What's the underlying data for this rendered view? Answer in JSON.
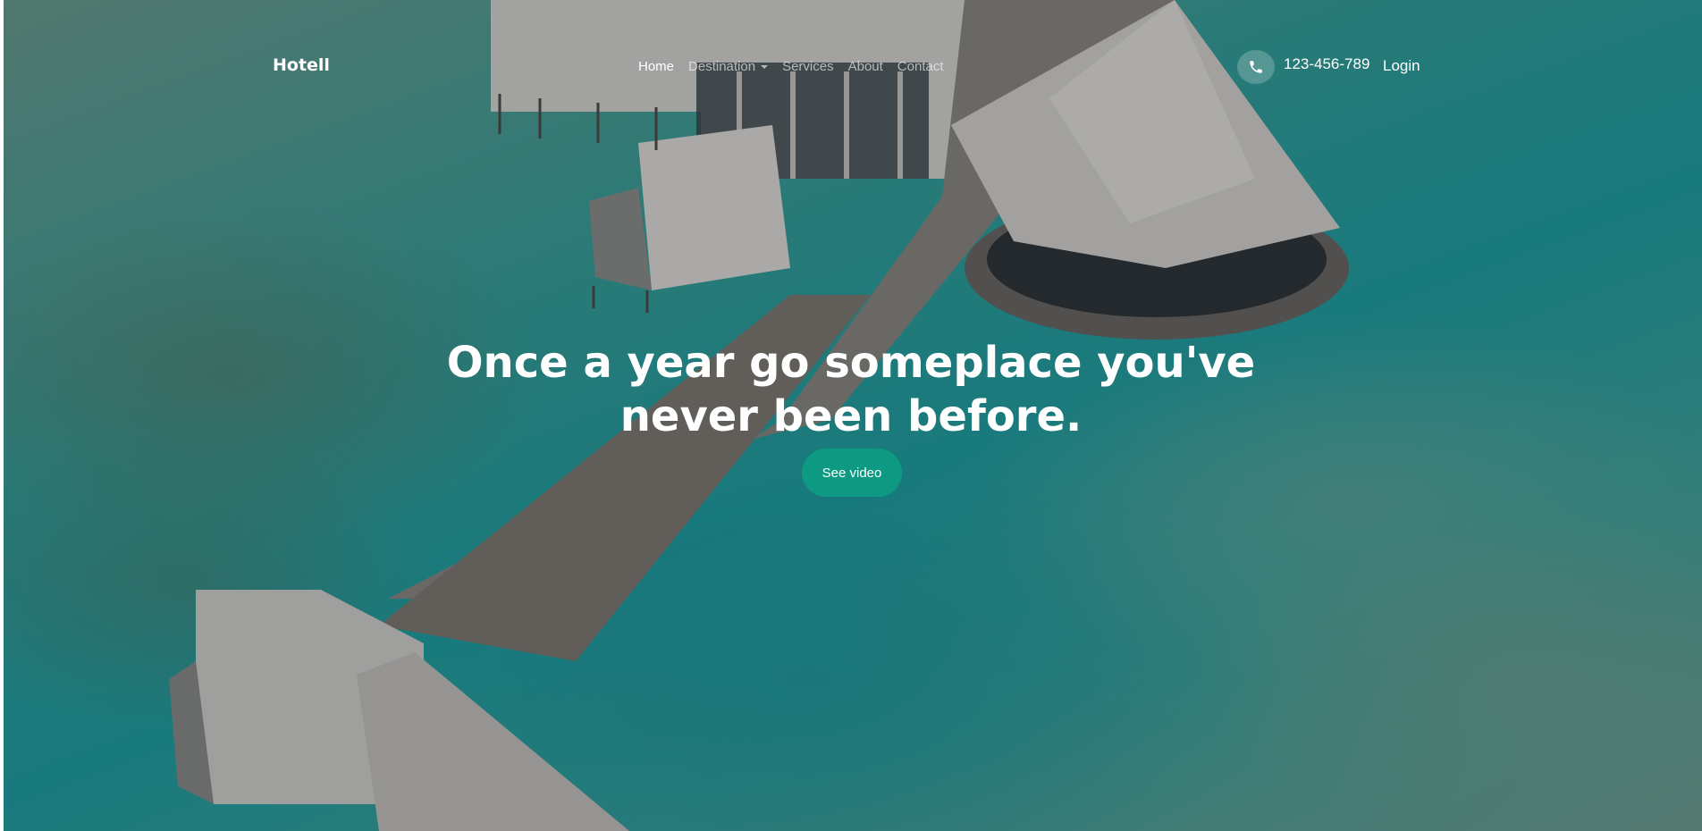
{
  "brand": {
    "name": "Hotell"
  },
  "nav": {
    "items": [
      {
        "label": "Home",
        "active": true
      },
      {
        "label": "Destination",
        "dropdown": true
      },
      {
        "label": "Services"
      },
      {
        "label": "About"
      },
      {
        "label": "Contact"
      }
    ]
  },
  "contact": {
    "phone": "123-456-789",
    "icon": "phone-icon"
  },
  "auth": {
    "login_label": "Login"
  },
  "hero": {
    "title_line1": "Once a year go someplace you've",
    "title_line2": "never been before.",
    "cta_label": "See video"
  },
  "colors": {
    "accent": "#0e9a82",
    "nav_inactive": "rgba(255,255,255,0.62)",
    "text": "#ffffff"
  }
}
